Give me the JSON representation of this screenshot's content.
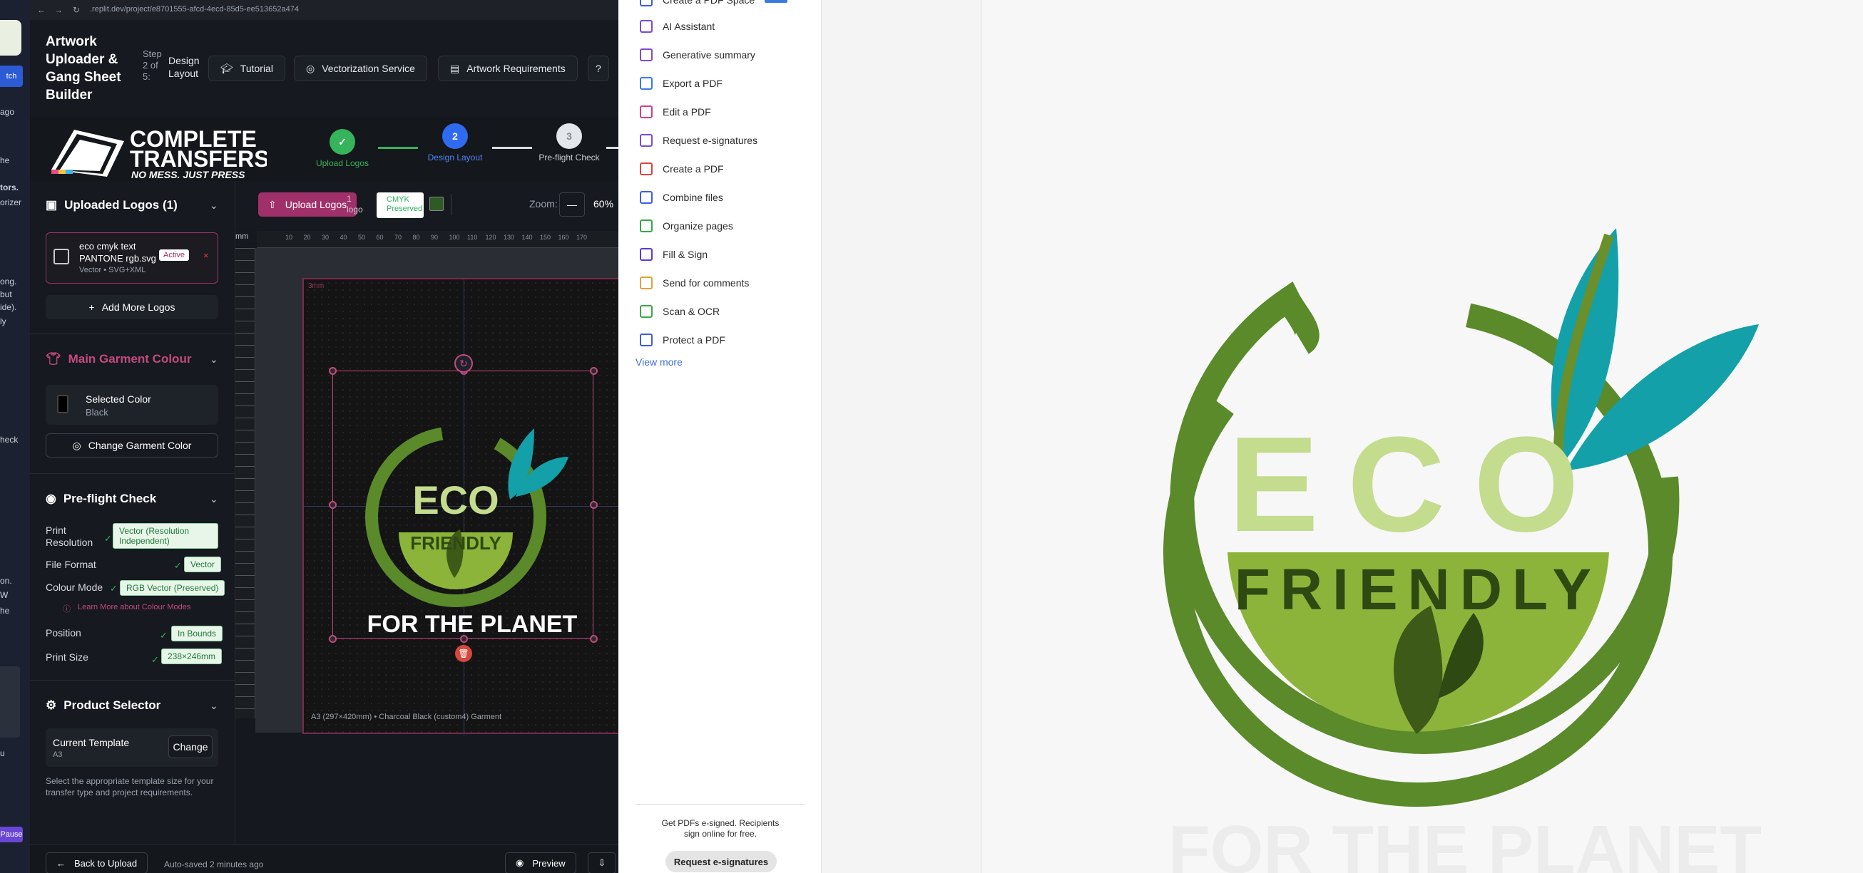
{
  "left_strip": {
    "fragments": [
      "ago",
      "he",
      "tors.",
      "orizer",
      "ong.",
      "but",
      "ide).",
      "ly",
      "heck",
      "on.",
      "W",
      "he",
      "u"
    ],
    "buttons": [
      "tch",
      "Pause"
    ]
  },
  "browser": {
    "url": ".replit.dev/project/e8701555-afcd-4ecd-85d5-ee513652a474"
  },
  "app": {
    "title": "Artwork Uploader & Gang Sheet Builder",
    "step_label": "Step 2 of 5:",
    "step_name": "Design Layout",
    "header_buttons": [
      "Tutorial",
      "Vectorization Service",
      "Artwork Requirements"
    ]
  },
  "brand": {
    "name_line1": "COMPLETE",
    "name_line2": "TRANSFERS",
    "tagline": "NO MESS, JUST PRESS"
  },
  "stepper": [
    {
      "num": "✓",
      "label": "Upload Logos",
      "state": "done"
    },
    {
      "num": "2",
      "label": "Design Layout",
      "state": "active"
    },
    {
      "num": "3",
      "label": "Pre-flight Check",
      "state": "todo"
    }
  ],
  "sidebar": {
    "uploaded": {
      "title": "Uploaded Logos (1)",
      "file_name": "eco cmyk text PANTONE rgb.svg",
      "file_meta": "Vector • SVG+XML",
      "active_badge": "Active",
      "remove": "×",
      "add_more": "Add More Logos"
    },
    "garment": {
      "title": "Main Garment Colour",
      "selected_label": "Selected Color",
      "selected_value": "Black",
      "change_button": "Change Garment Color"
    },
    "preflight": {
      "title": "Pre-flight Check",
      "rows": [
        {
          "label": "Print Resolution",
          "value": "Vector (Resolution Independent)"
        },
        {
          "label": "File Format",
          "value": "Vector"
        },
        {
          "label": "Colour Mode",
          "value": "RGB Vector (Preserved)"
        },
        {
          "label": "Position",
          "value": "In Bounds"
        },
        {
          "label": "Print Size",
          "value": "238×246mm"
        }
      ],
      "learn_more": "Learn More about Colour Modes"
    },
    "product": {
      "title": "Product Selector",
      "current_label": "Current Template",
      "current_value": "A3",
      "change_button": "Change",
      "help": "Select the appropriate template size for your transfer type and project requirements."
    }
  },
  "toolbar": {
    "upload_button": "Upload Logos",
    "logo_count": "1 logo",
    "cmyk_badge": "CMYK Preserved",
    "zoom_label": "Zoom:",
    "zoom_minus": "—",
    "zoom_value": "60%"
  },
  "canvas": {
    "unit": "mm",
    "ruler_ticks": [
      "10",
      "20",
      "30",
      "40",
      "50",
      "60",
      "70",
      "80",
      "90",
      "100",
      "110",
      "120",
      "130",
      "140",
      "150",
      "160",
      "170"
    ],
    "bleed_label": "3mm",
    "footer": "A3 (297×420mm) • Charcoal Black (custom4) Garment",
    "artwork": {
      "word1": "ECO",
      "word2": "FRIENDLY",
      "caption": "FOR THE PLANET"
    }
  },
  "bottom_bar": {
    "back": "Back to Upload",
    "autosave": "Auto-saved 2 minutes ago",
    "preview": "Preview"
  },
  "acrobat": {
    "top_partial": "Create a PDF Space",
    "tools": [
      {
        "label": "AI Assistant",
        "color": "#7b4bd6"
      },
      {
        "label": "Generative summary",
        "color": "#7b4bd6"
      },
      {
        "label": "Export a PDF",
        "color": "#3b7be0"
      },
      {
        "label": "Edit a PDF",
        "color": "#d63e8a"
      },
      {
        "label": "Request e-signatures",
        "color": "#7b4bd6"
      },
      {
        "label": "Create a PDF",
        "color": "#e0413b"
      },
      {
        "label": "Combine files",
        "color": "#3b5fe0"
      },
      {
        "label": "Organize pages",
        "color": "#39a845"
      },
      {
        "label": "Fill & Sign",
        "color": "#5a3bd6"
      },
      {
        "label": "Send for comments",
        "color": "#e0a23b"
      },
      {
        "label": "Scan & OCR",
        "color": "#39a845"
      },
      {
        "label": "Protect a PDF",
        "color": "#3b5fe0"
      }
    ],
    "view_more": "View more",
    "promo": "Get PDFs e-signed. Recipients sign online for free.",
    "promo_button": "Request e-signatures"
  },
  "pdf_page": {
    "word1": "ECO",
    "word2": "FRIENDLY",
    "caption": "FOR THE PLANET"
  },
  "colors": {
    "dark_green": "#5a8a2a",
    "light_green": "#8db43a",
    "pale_green": "#c4dc8e",
    "teal": "#13a0a8",
    "leaf_dark": "#3d5a18",
    "accent_pink": "#a0306a"
  }
}
